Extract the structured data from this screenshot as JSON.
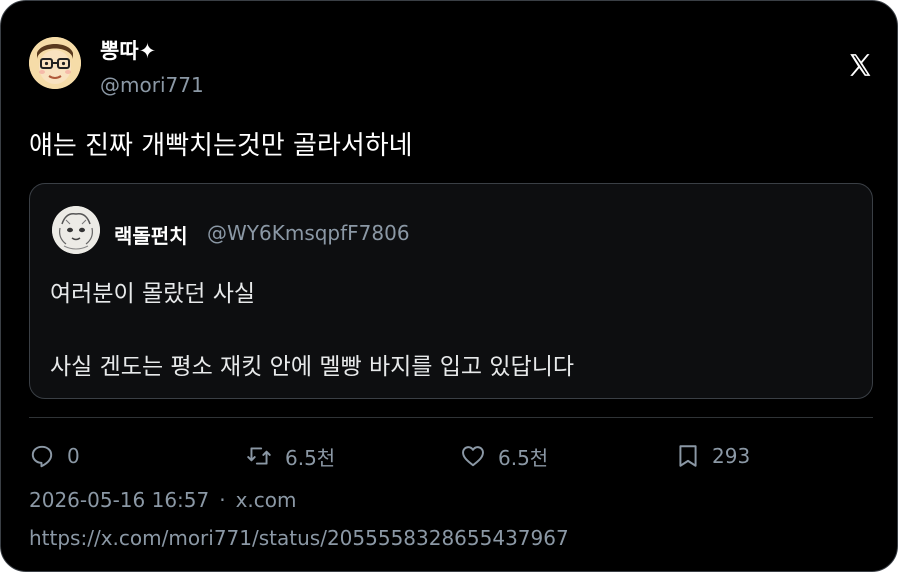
{
  "author": {
    "display_name": "뽕따✦",
    "handle": "@mori771",
    "avatar_icon": "cartoon-face-with-glasses-avatar"
  },
  "brand": {
    "logo_icon": "x-logo-icon"
  },
  "tweet": {
    "text": "얘는 진짜 개빡치는것만 골라서하네"
  },
  "quoted": {
    "display_name": "랙돌펀치",
    "handle": "@WY6KmsqpfF7806",
    "avatar_icon": "sketched-animal-avatar",
    "line1": "여러분이 몰랐던 사실",
    "line2": "사실 겐도는 평소 재킷 안에 멜빵 바지를 입고 있답니다"
  },
  "actions": {
    "replies": "0",
    "reposts": "6.5천",
    "likes": "6.5천",
    "bookmarks": "293"
  },
  "meta": {
    "timestamp": "2026-05-16 16:57",
    "separator": "·",
    "source": "x.com",
    "url": "https://x.com/mori771/status/2055558328655437967"
  },
  "colors": {
    "background": "#000000",
    "text_primary": "#e7e9ea",
    "text_secondary": "#8b98a5",
    "border": "#3a3f45"
  }
}
